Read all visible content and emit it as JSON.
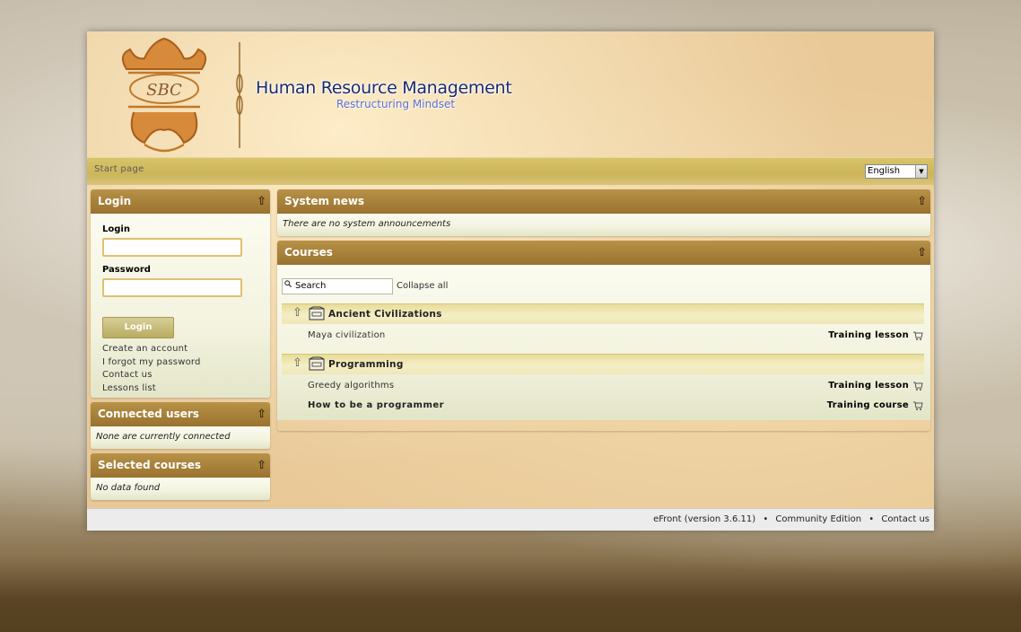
{
  "header": {
    "logo_text": "SBC",
    "title": "Human Resource Management",
    "subtitle": "Restructuring Mindset"
  },
  "navbar": {
    "breadcrumb": "Start page",
    "language": "English"
  },
  "login_panel": {
    "title": "Login",
    "login_label": "Login",
    "login_value": "",
    "password_label": "Password",
    "password_value": "",
    "button_label": "Login",
    "links": [
      "Create an account",
      "I forgot my password",
      "Contact us",
      "Lessons list"
    ]
  },
  "connected_users": {
    "title": "Connected users",
    "message": "None are currently connected"
  },
  "selected_courses": {
    "title": "Selected courses",
    "message": "No data found"
  },
  "system_news": {
    "title": "System news",
    "message": "There are no system announcements"
  },
  "courses": {
    "title": "Courses",
    "search_placeholder": "Search",
    "collapse_all": "Collapse all",
    "categories": [
      {
        "name": "Ancient Civilizations",
        "items": [
          {
            "name": "Maya civilization",
            "type": "Training lesson"
          }
        ]
      },
      {
        "name": "Programming",
        "items": [
          {
            "name": "Greedy algorithms",
            "type": "Training lesson"
          },
          {
            "name": "How to be a programmer",
            "type": "Training course"
          }
        ]
      }
    ]
  },
  "footer": {
    "version": "eFront (version 3.6.11)",
    "edition": "Community Edition",
    "contact": "Contact us",
    "separator": "•"
  },
  "colors": {
    "panel_header": "#a8813a",
    "title_blue": "#1a2a6a",
    "subtitle_blue": "#5a6fd0",
    "navbar": "#cdb55a"
  }
}
